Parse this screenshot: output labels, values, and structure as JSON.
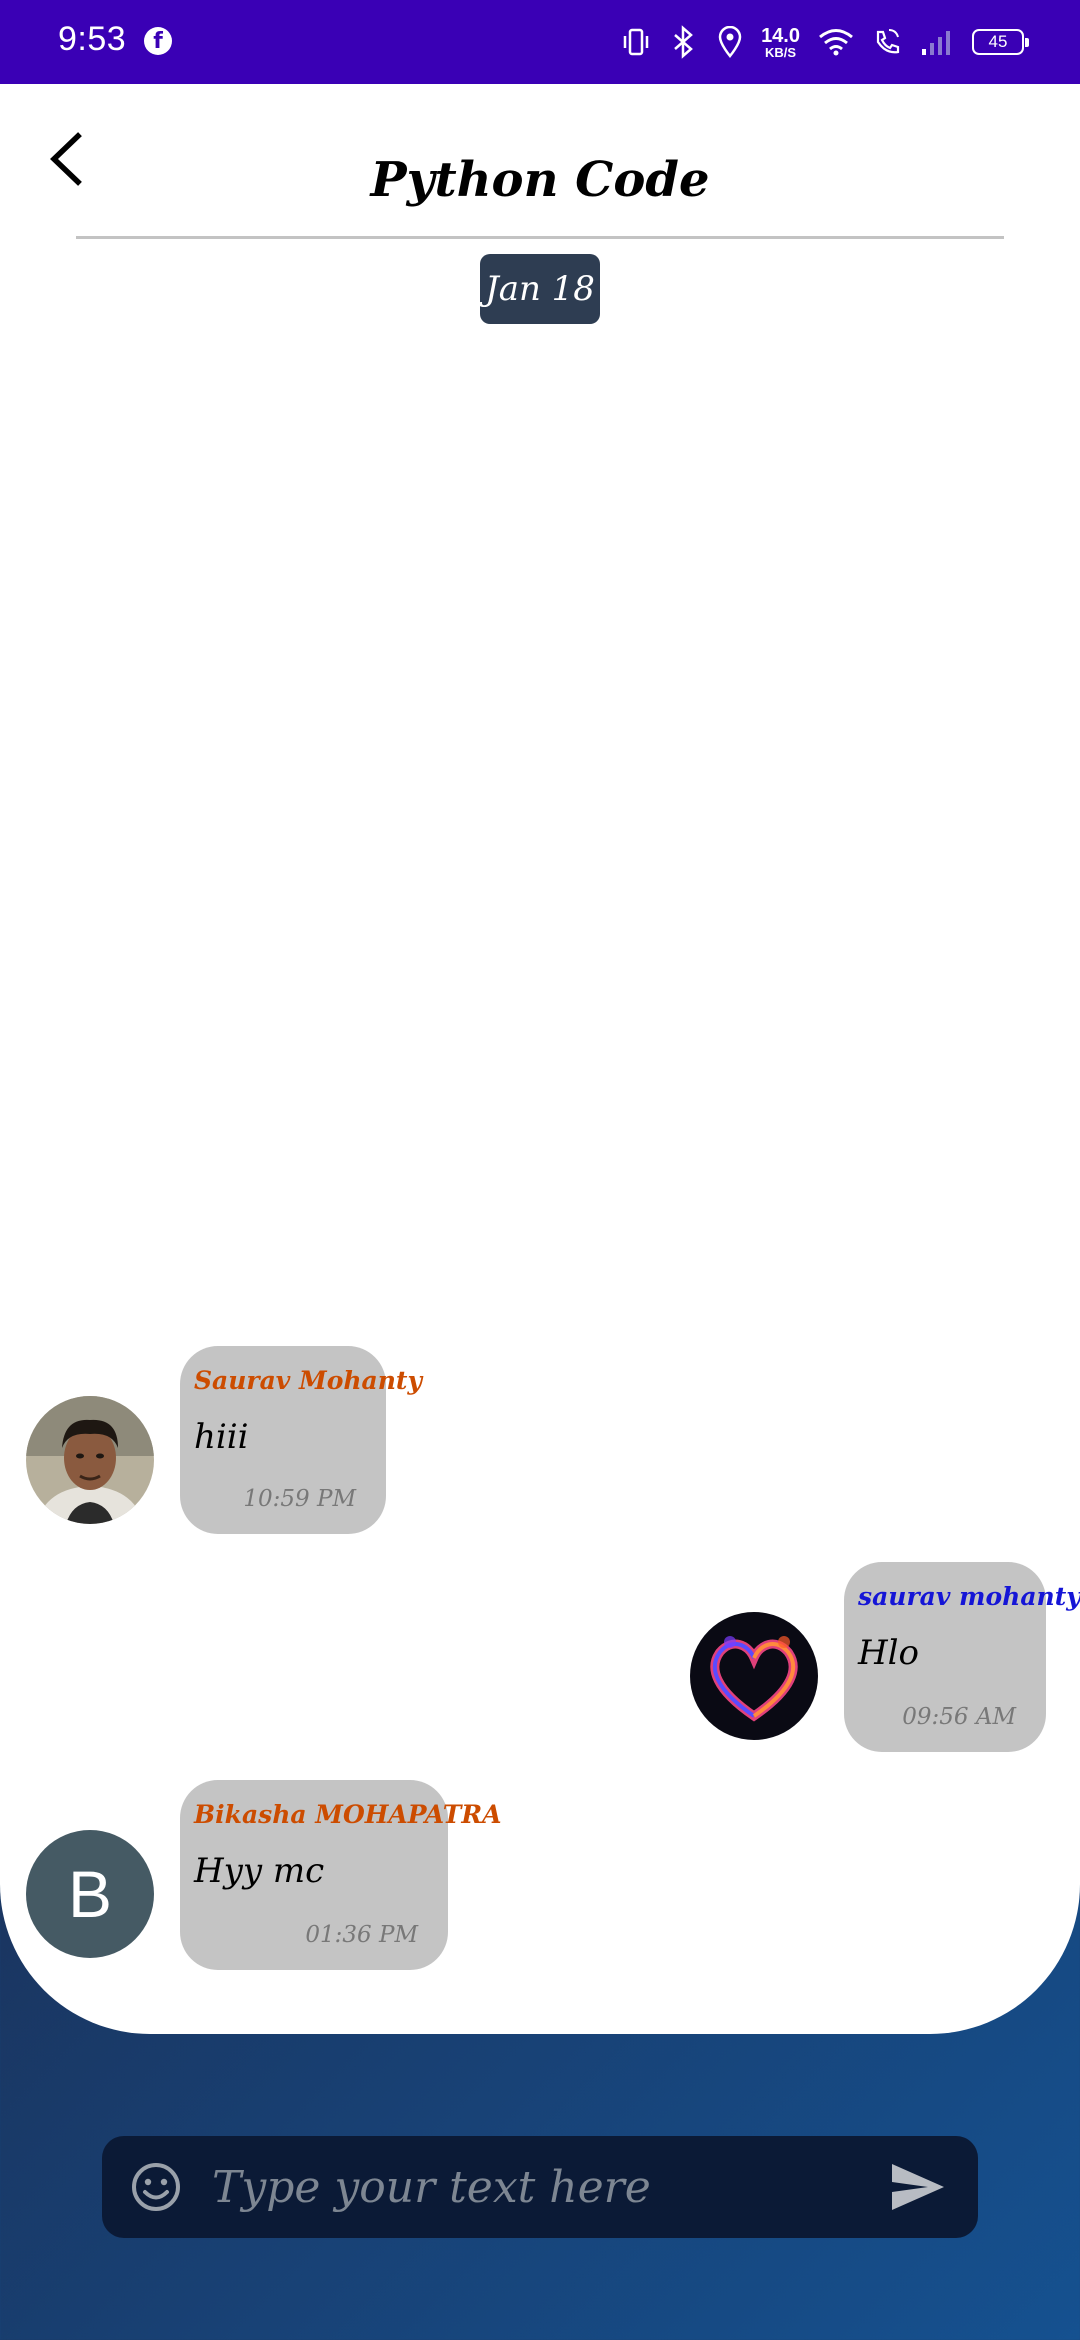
{
  "status_bar": {
    "time": "9:53",
    "app_icon": "facebook-icon",
    "net_speed_value": "14.0",
    "net_speed_unit": "KB/S",
    "battery": "45"
  },
  "header": {
    "title": "Python Code",
    "back_icon": "chevron-left-icon"
  },
  "date_chip": "Jan 18",
  "messages": [
    {
      "sender": "Saurav Mohanty",
      "text": "hiii",
      "time": "10:59 PM",
      "side": "left",
      "avatar": "photo"
    },
    {
      "sender": "saurav mohanty",
      "text": "Hlo",
      "time": "09:56 AM",
      "side": "right",
      "avatar": "heart-image"
    },
    {
      "sender": "Bikasha MOHAPATRA",
      "text": "Hyy mc",
      "time": "01:36 PM",
      "side": "left",
      "avatar_letter": "B"
    }
  ],
  "composer": {
    "placeholder": "Type your text here",
    "emoji_icon": "smiley-icon",
    "send_icon": "send-icon"
  },
  "colors": {
    "status_bar": "#3a00b5",
    "bubble": "#c4c4c4",
    "sender_other": "#cc4c00",
    "sender_self": "#1515d6",
    "date_chip": "#2e3d52",
    "composer": "#0b1a36"
  }
}
